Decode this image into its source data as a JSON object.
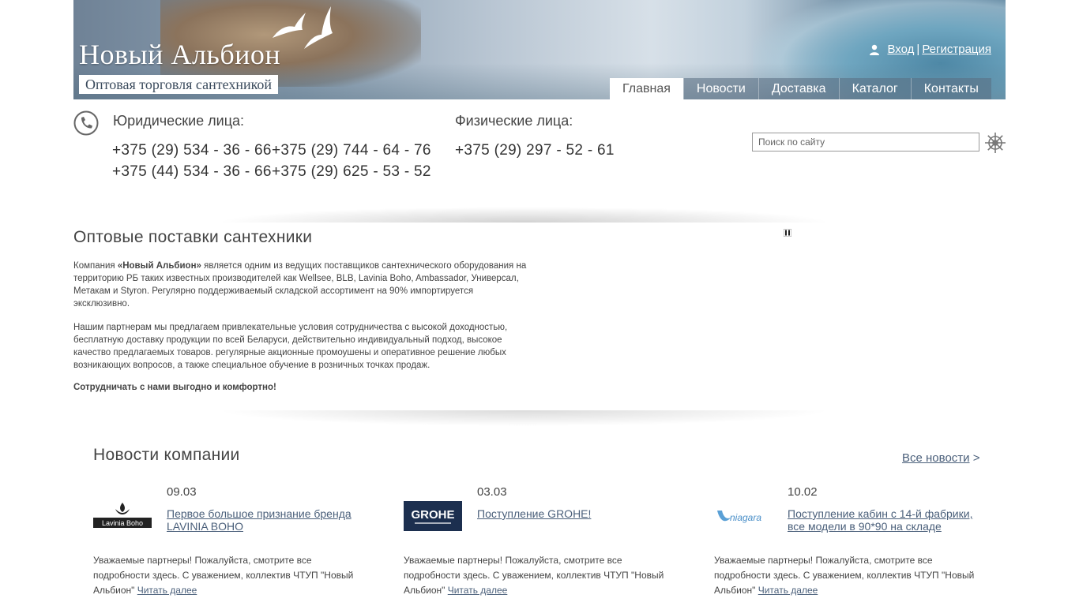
{
  "header": {
    "logo_title": "Новый Альбион",
    "logo_subtitle": "Оптовая торговля сантехникой",
    "login": "Вход",
    "separator": "|",
    "register": "Регистрация",
    "nav": [
      "Главная",
      "Новости",
      "Доставка",
      "Каталог",
      "Контакты"
    ],
    "active_nav": "Главная"
  },
  "contacts": {
    "legal_heading": "Юридические лица:",
    "legal_phones": [
      "+375 (29) 534 - 36 - 66",
      "+375 (29) 744 - 64 - 76",
      "+375 (44) 534 - 36 - 66",
      "+375 (29) 625 - 53 - 52"
    ],
    "individual_heading": "Физические лица:",
    "individual_phones": [
      "+375 (29) 297 - 52 - 61"
    ]
  },
  "search": {
    "placeholder": "Поиск по сайту"
  },
  "intro": {
    "title": "Оптовые поставки сантехники",
    "p1_prefix": "Компания ",
    "p1_bold": "«Новый Альбион»",
    "p1_rest": " является одним из ведущих поставщиков сантехнического оборудования на территорию РБ таких известных производителей как Wellsee, BLB, Lavinia Boho, Ambassador, Универсал, Метакам и Styron. Регулярно поддерживаемый складской ассортимент на 90% импортируется эксклюзивно.",
    "p2": "Нашим партнерам мы предлагаем привлекательные условия сотрудничества с высокой доходностью, бесплатную доставку продукции по всей Беларуси, действительно индивидуальный подход, высокое качество предлагаемых товаров. регулярные акционные промоушены и оперативное решение любых возникающих вопросов, а также специальное обучение в розничных точках продаж.",
    "bold_line": "Сотрудничать с нами выгодно и комфортно!"
  },
  "news": {
    "title": "Новости компании",
    "all_news": "Все новости",
    "all_news_arrow": ">",
    "items": [
      {
        "date": "09.03",
        "logo": "Lavinia Boho",
        "title": "Первое большое признание бренда LAVINIA BOHO",
        "text": "Уважаемые партнеры! Пожалуйста, смотрите все подробности здесь. С уважением, коллектив ЧТУП \"Новый Альбион\" ",
        "more": "Читать далее"
      },
      {
        "date": "03.03",
        "logo": "GROHE",
        "title": "Поступление GROHE!",
        "text": "Уважаемые партнеры! Пожалуйста, смотрите все подробности здесь. С уважением, коллектив ЧТУП \"Новый Альбион\" ",
        "more": "Читать далее"
      },
      {
        "date": "10.02",
        "logo": "niagara",
        "title": "Поступление кабин с 14-й фабрики, все модели в 90*90 на складе",
        "text": "Уважаемые партнеры! Пожалуйста, смотрите все подробности здесь. С уважением, коллектив ЧТУП \"Новый Альбион\" ",
        "more": "Читать далее"
      }
    ]
  },
  "colors": {
    "link": "#4a5f7a",
    "text": "#444444",
    "grohe_bg": "#1c2f4f"
  },
  "icons": [
    "user-icon",
    "phone-icon",
    "helm-icon",
    "gulls-logo",
    "slider-pause-icon"
  ]
}
